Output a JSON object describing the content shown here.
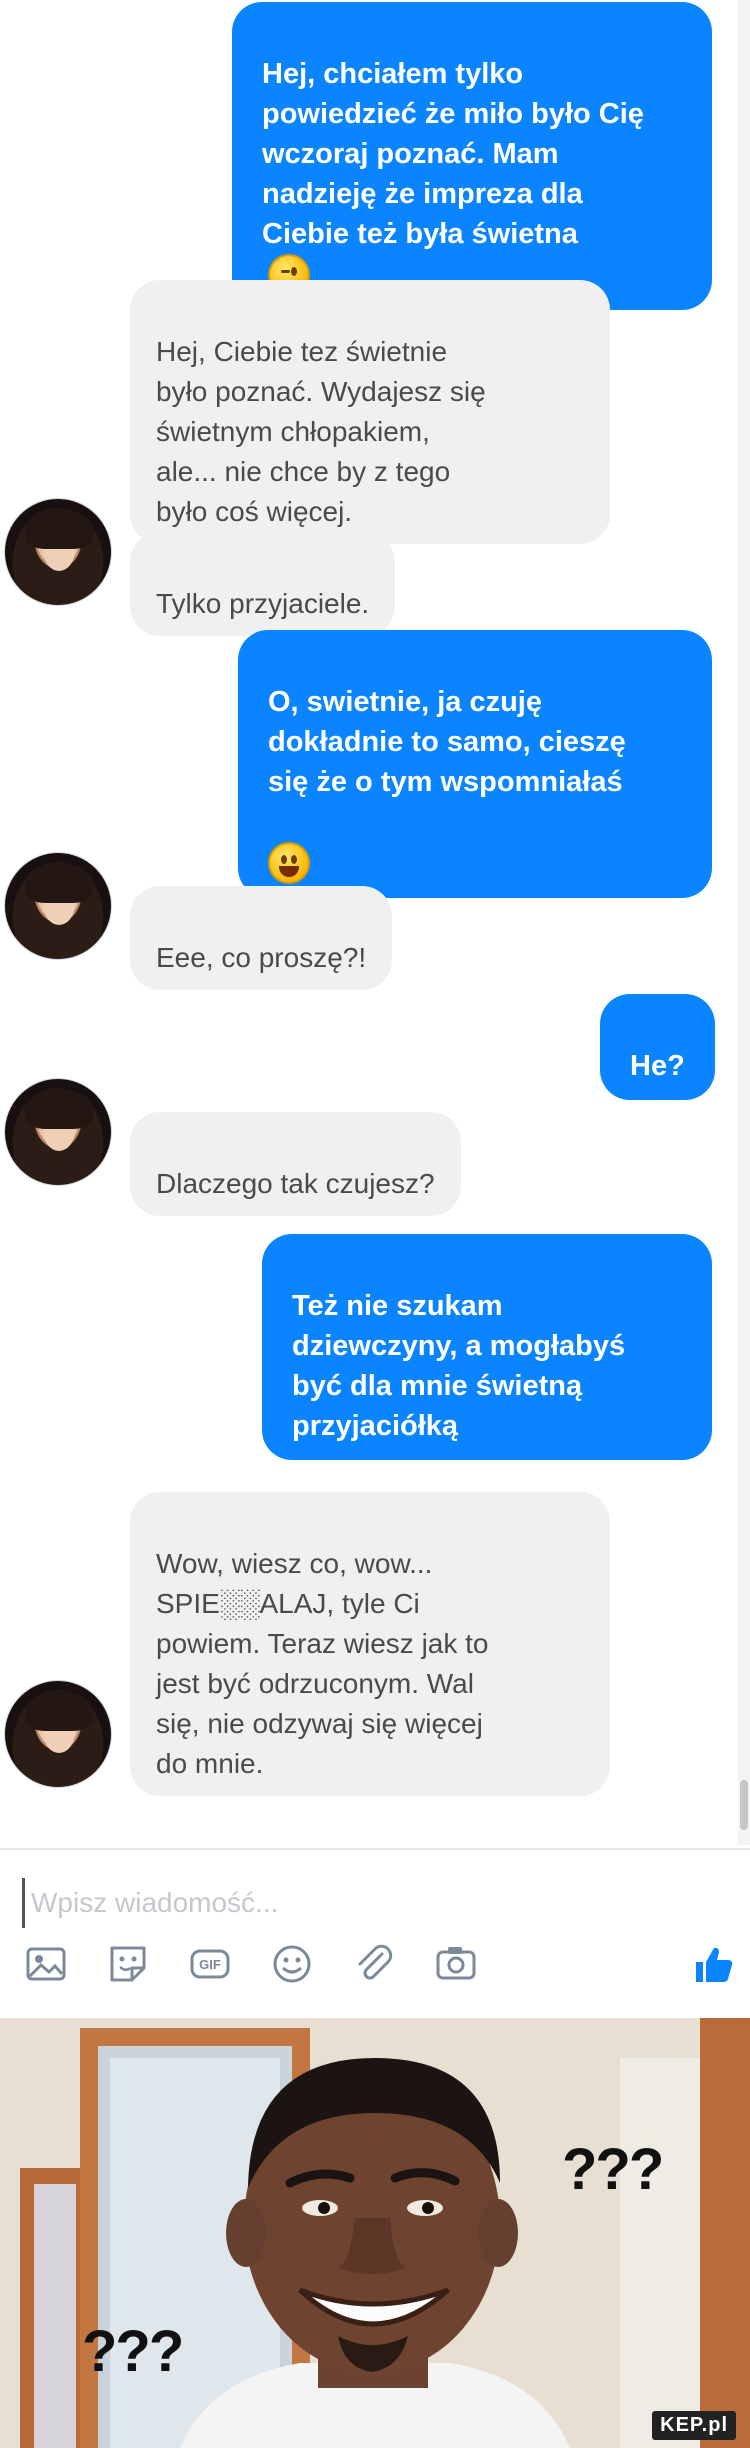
{
  "messages": [
    {
      "id": "m1",
      "direction": "out",
      "text": "Hej, chciałem tylko\npowiedzieć że miło było Cię\nwczoraj poznać. Mam\nnadzieję że impreza dla\nCiebie też była świetna",
      "emoji": "wink-emoji"
    },
    {
      "id": "m2",
      "direction": "in",
      "text": "Hej, Ciebie tez świetnie\nbyło poznać. Wydajesz się\nświetnym chłopakiem,\nale... nie chce by z tego\nbyło coś więcej."
    },
    {
      "id": "m3",
      "direction": "in",
      "text": "Tylko przyjaciele."
    },
    {
      "id": "m4",
      "direction": "out",
      "text": "O, swietnie, ja czuję\ndokładnie to samo, cieszę\nsię że o tym wspomniałaś",
      "emoji": "grin-emoji"
    },
    {
      "id": "m5",
      "direction": "in",
      "text": "Eee, co proszę?!"
    },
    {
      "id": "m6",
      "direction": "out",
      "text": "He?"
    },
    {
      "id": "m7",
      "direction": "in",
      "text": "Dlaczego tak czujesz?"
    },
    {
      "id": "m8",
      "direction": "out",
      "text": "Też nie szukam\ndziewczyny, a mogłabyś\nbyć dla mnie świetną\nprzyjaciółką"
    },
    {
      "id": "m9",
      "direction": "in",
      "text": "Wow, wiesz co, wow...\nSPIE░░ALAJ, tyle Ci\npowiem. Teraz wiesz jak to\njest być odrzuconym. Wal\nsię, nie odzywaj się więcej\ndo mnie."
    }
  ],
  "composer": {
    "placeholder": "Wpisz wiadomość..."
  },
  "toolbar": {
    "icons": [
      "image-icon",
      "sticker-icon",
      "gif-icon",
      "emoji-icon",
      "attachment-icon",
      "camera-icon",
      "like-icon"
    ],
    "gif_label": "GIF"
  },
  "meme": {
    "left_text": "???",
    "right_text": "???",
    "watermark": "KEP.pl"
  },
  "colors": {
    "outgoing_bubble": "#0b84ff",
    "incoming_bubble": "#f0f0f1",
    "accent": "#0b84ff"
  }
}
